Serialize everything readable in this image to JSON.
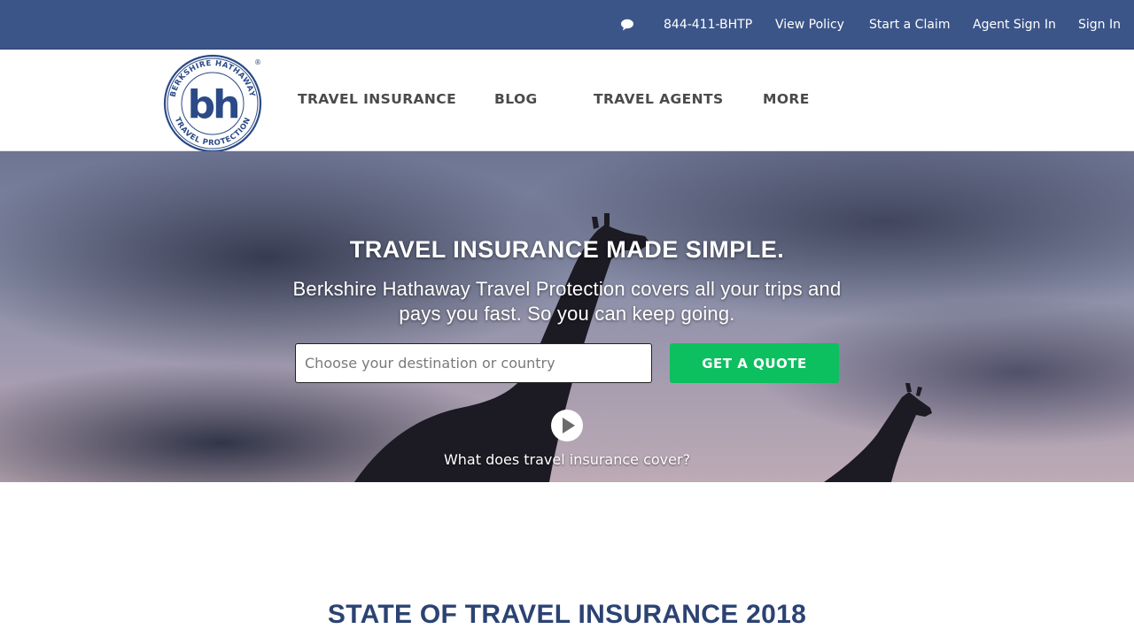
{
  "utility_bar": {
    "phone": "844-411-BHTP",
    "links": [
      "View Policy",
      "Start a Claim",
      "Agent Sign In",
      "Sign In"
    ],
    "chat_icon": "chat-bubble-icon",
    "background": "#3b5588"
  },
  "logo": {
    "ring_text": "BERKSHIRE HATHAWAY",
    "ring_text_bottom": "TRAVEL PROTECTION",
    "monogram": "bh",
    "registered": "®",
    "color": "#2b4a86"
  },
  "nav": {
    "items": [
      "TRAVEL INSURANCE",
      "BLOG",
      "TRAVEL AGENTS",
      "MORE"
    ]
  },
  "hero": {
    "title": "TRAVEL INSURANCE MADE SIMPLE.",
    "subtitle": "Berkshire Hathaway Travel Protection covers all your trips and pays you fast. So you can keep going.",
    "search": {
      "placeholder": "Choose your destination or country",
      "value": ""
    },
    "cta_label": "GET A QUOTE",
    "cta_color": "#0cbf5f",
    "video_icon": "play-icon",
    "video_link": "What does travel insurance cover?"
  },
  "section": {
    "title": "STATE OF TRAVEL INSURANCE 2018",
    "title_color": "#2b4372"
  }
}
